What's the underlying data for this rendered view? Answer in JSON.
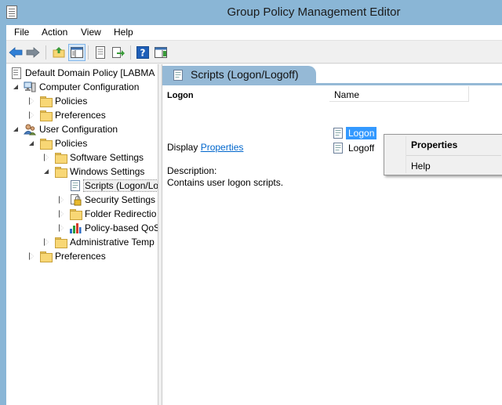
{
  "window": {
    "title": "Group Policy Management Editor"
  },
  "menubar": {
    "items": [
      "File",
      "Action",
      "View",
      "Help"
    ]
  },
  "toolbar": {
    "buttons": [
      "back-arrow-icon",
      "forward-arrow-icon",
      "up-folder-icon",
      "show-hide-tree-icon",
      "properties-icon",
      "export-list-icon",
      "help-icon",
      "show-action-pane-icon"
    ]
  },
  "tree": {
    "items": [
      {
        "label": "Default Domain Policy [LABMA",
        "icon": "policy-doc-icon",
        "expander": "none"
      },
      {
        "label": "Computer Configuration",
        "icon": "computer-icon",
        "expander": "open"
      },
      {
        "label": "Policies",
        "icon": "folder-icon",
        "expander": "closed"
      },
      {
        "label": "Preferences",
        "icon": "folder-icon",
        "expander": "closed"
      },
      {
        "label": "User Configuration",
        "icon": "users-icon",
        "expander": "open"
      },
      {
        "label": "Policies",
        "icon": "folder-icon",
        "expander": "open"
      },
      {
        "label": "Software Settings",
        "icon": "folder-icon",
        "expander": "closed"
      },
      {
        "label": "Windows Settings",
        "icon": "folder-icon",
        "expander": "open"
      },
      {
        "label": "Scripts (Logon/Lo",
        "icon": "scripts-icon",
        "expander": "none",
        "selected": true
      },
      {
        "label": "Security Settings",
        "icon": "security-icon",
        "expander": "closed"
      },
      {
        "label": "Folder Redirectio",
        "icon": "folder-icon",
        "expander": "closed"
      },
      {
        "label": "Policy-based QoS",
        "icon": "chart-icon",
        "expander": "closed"
      },
      {
        "label": "Administrative Temp",
        "icon": "folder-icon",
        "expander": "closed"
      },
      {
        "label": "Preferences",
        "icon": "folder-icon",
        "expander": "closed"
      }
    ]
  },
  "right_pane": {
    "header_title": "Scripts (Logon/Logoff)",
    "heading": "Logon",
    "display_prefix": "Display ",
    "display_link": "Properties",
    "description_label": "Description:",
    "description_text": "Contains user logon scripts.",
    "list": {
      "column_name": "Name",
      "rows": [
        {
          "label": "Logon",
          "selected": true
        },
        {
          "label": "Logoff",
          "selected": false
        }
      ]
    }
  },
  "context_menu": {
    "items": [
      "Properties",
      "Help"
    ]
  },
  "colors": {
    "titlebar": "#8ab6d6",
    "header_tab": "#95b9d6",
    "selection": "#3399ff",
    "link": "#0066cc"
  }
}
